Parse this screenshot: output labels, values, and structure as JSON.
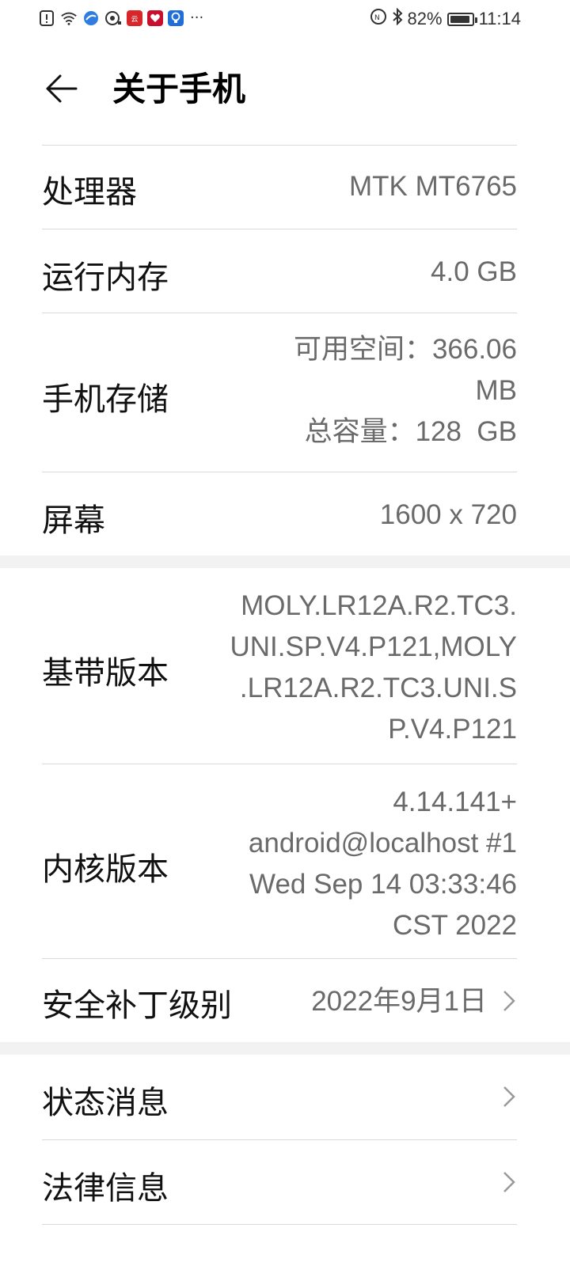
{
  "status_bar": {
    "battery_percent": "82%",
    "time": "11:14",
    "more": "···",
    "icons": [
      "alert-icon",
      "wifi-icon",
      "browser-icon",
      "camera-icon",
      "app-icon-red",
      "app-icon-red-2",
      "bulb-icon",
      "nfc-icon",
      "bluetooth-icon",
      "battery-icon"
    ]
  },
  "header": {
    "title": "关于手机"
  },
  "rows": {
    "processor": {
      "label": "处理器",
      "value": "MTK MT6765"
    },
    "ram": {
      "label": "运行内存",
      "value": "4.0 GB"
    },
    "storage": {
      "label": "手机存储",
      "lines": [
        "可用空间：366.06",
        "MB",
        "总容量：128  GB"
      ]
    },
    "screen": {
      "label": "屏幕",
      "value": "1600 x 720"
    },
    "baseband": {
      "label": "基带版本",
      "lines": [
        "MOLY.LR12A.R2.TC3.",
        "UNI.SP.V4.P121,MOLY",
        ".LR12A.R2.TC3.UNI.S",
        "P.V4.P121"
      ]
    },
    "kernel": {
      "label": "内核版本",
      "lines": [
        "4.14.141+",
        "android@localhost #1",
        "Wed Sep 14 03:33:46",
        "CST 2022"
      ]
    },
    "security_patch": {
      "label": "安全补丁级别",
      "value": "2022年9月1日"
    }
  },
  "menu": {
    "status": {
      "label": "状态消息"
    },
    "legal": {
      "label": "法律信息"
    }
  },
  "colors": {
    "background": "#ffffff",
    "section_gap": "#f2f2f2",
    "value_text": "#6a6a6a",
    "divider": "#d9d9d9"
  }
}
